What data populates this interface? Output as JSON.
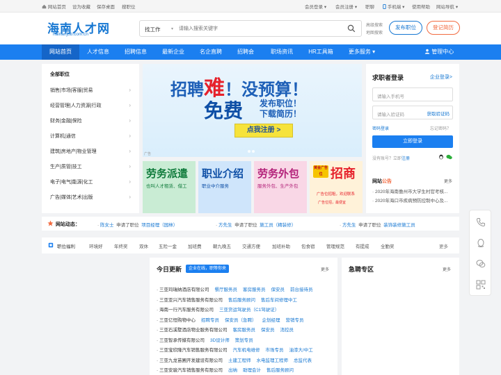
{
  "topbar": {
    "left": [
      {
        "label": "网站首页",
        "icon": "home-icon"
      },
      {
        "label": "设为收藏"
      },
      {
        "label": "保存桌面"
      },
      {
        "label": "搜职位"
      }
    ],
    "right": [
      {
        "label": "会员登录",
        "dropdown": true
      },
      {
        "label": "会员注册",
        "dropdown": true
      },
      {
        "label": "职聊"
      },
      {
        "label": "手机端",
        "dropdown": true
      },
      {
        "label": "使用帮助"
      },
      {
        "label": "网站导航",
        "dropdown": true
      }
    ]
  },
  "header": {
    "logo_text": "海南人才网",
    "logo_domain": "hainanjob.com.cn",
    "search_type": "找工作",
    "search_placeholder": "请输入搜索关键字",
    "hot_links": [
      "高级搜索",
      "地图搜索"
    ],
    "post_job_label": "发布职位",
    "register_label": "登记简历"
  },
  "nav": {
    "items": [
      "网站首页",
      "人才信息",
      "招聘信息",
      "最新企业",
      "名企直聘",
      "招聘会",
      "职场资讯",
      "HR工具箱",
      "更多服务"
    ],
    "active_index": 0,
    "admin_label": "管理中心"
  },
  "categories": {
    "title": "全部职位",
    "items": [
      "销售|市场|客服|贸易",
      "经营管理|人力资源|行政",
      "财务|金融|保险",
      "计算机|通信",
      "建筑|房地产|物业管理",
      "生产|质管|技工",
      "电子|电气|能源|化工",
      "广告|媒体|艺术|出版"
    ]
  },
  "banner": {
    "line1_a": "招聘",
    "line1_red": "难",
    "line1_b": "！没预算！",
    "free": "免费",
    "line2_a": "发布职位！",
    "line2_b": "下载简历！",
    "cta": "点我注册 >",
    "ad_mark": "广告"
  },
  "tiles": [
    {
      "title": "劳务派遣",
      "sub": "也叫人才租赁、借工",
      "bg": "#c9ecd4",
      "color": "#0e7a3a"
    },
    {
      "title": "职业介绍",
      "sub": "职业中介服务",
      "bg": "#cfe5fb",
      "color": "#0e4fa6"
    },
    {
      "title": "劳务外包",
      "sub": "服务外包、生产外包",
      "bg": "#f9d7e6",
      "color": "#b3237a"
    },
    {
      "title": "招商",
      "badge": "黄金广告位",
      "sub": "广告位招租，欢迎联系",
      "sub2": "广告位招，最便宜",
      "bg": "#fff2d9",
      "color": "#e6212b"
    }
  ],
  "login": {
    "title": "求职者登录",
    "employer_link": "企业登录>",
    "phone_placeholder": "请输入手机号",
    "code_placeholder": "请输入验证码",
    "get_code": "获取验证码",
    "password_login": "密码登录",
    "forgot": "忘记密码？",
    "submit": "立即登录",
    "no_account": "没有账号？立即",
    "register": "注册"
  },
  "notice": {
    "title_a": "网站",
    "title_b": "公告",
    "more": "更多",
    "items": [
      "2020年海南儋州市大学生村官考核...",
      "2020年海口市疾病预防控制中心及..."
    ]
  },
  "dynamics": {
    "label": "网站动态：",
    "items": [
      {
        "name": "陈女士",
        "action": "申请了职位",
        "job": "项目经理（园林）"
      },
      {
        "name": "方先生",
        "action": "申请了职位",
        "job": "施工员（精装修）"
      },
      {
        "name": "方先生",
        "action": "申请了职位",
        "job": "装饰装修施工员"
      }
    ]
  },
  "welfare": {
    "label": "职位福利",
    "items": [
      "环境好",
      "年终奖",
      "双休",
      "五险一金",
      "加班费",
      "朝九晚五",
      "交通方便",
      "加班补助",
      "包食宿",
      "管理规范",
      "有提成",
      "全勤奖"
    ],
    "more": "更多"
  },
  "updates": {
    "title": "今日更新",
    "badge": "企业在线，职等你来",
    "more": "更多",
    "rows": [
      {
        "company": "三亚玛瑞纳酒店有限公司",
        "jobs": [
          "餐厅服务员",
          "客房服务员",
          "保安员",
          "前台接待员"
        ]
      },
      {
        "company": "三亚亚兴汽车销售服务有限公司",
        "jobs": [
          "售后服务顾问",
          "售后车间修理中工"
        ]
      },
      {
        "company": "海南一行汽车服务有限公司",
        "jobs": [
          "三亚货运驾驶员（C1驾驶证）"
        ]
      },
      {
        "company": "三亚亿恒购物中心",
        "jobs": [
          "招聘专员",
          "保安员（急聘）",
          "企划经理",
          "营销专员"
        ]
      },
      {
        "company": "三亚石溪墅酒店物业服务有限公司",
        "jobs": [
          "客房服务员",
          "保安员",
          "消控员"
        ]
      },
      {
        "company": "三亚智承传媒有限公司",
        "jobs": [
          "3D设计师",
          "策划专员"
        ]
      },
      {
        "company": "三亚宝欣隆汽车销售服务有限公司",
        "jobs": [
          "汽车机电维修",
          "市场专员",
          "油漆大/中工"
        ]
      },
      {
        "company": "三亚九龙苗圃开发建设有限公司",
        "jobs": [
          "土建工程师",
          "水电监理工程师",
          "总监代表"
        ]
      },
      {
        "company": "三亚安骏汽车销售服务有限公司",
        "jobs": [
          "出纳",
          "助理会计",
          "售后服务顾问"
        ]
      }
    ]
  },
  "urgent": {
    "title": "急聘专区",
    "more": "更多"
  }
}
